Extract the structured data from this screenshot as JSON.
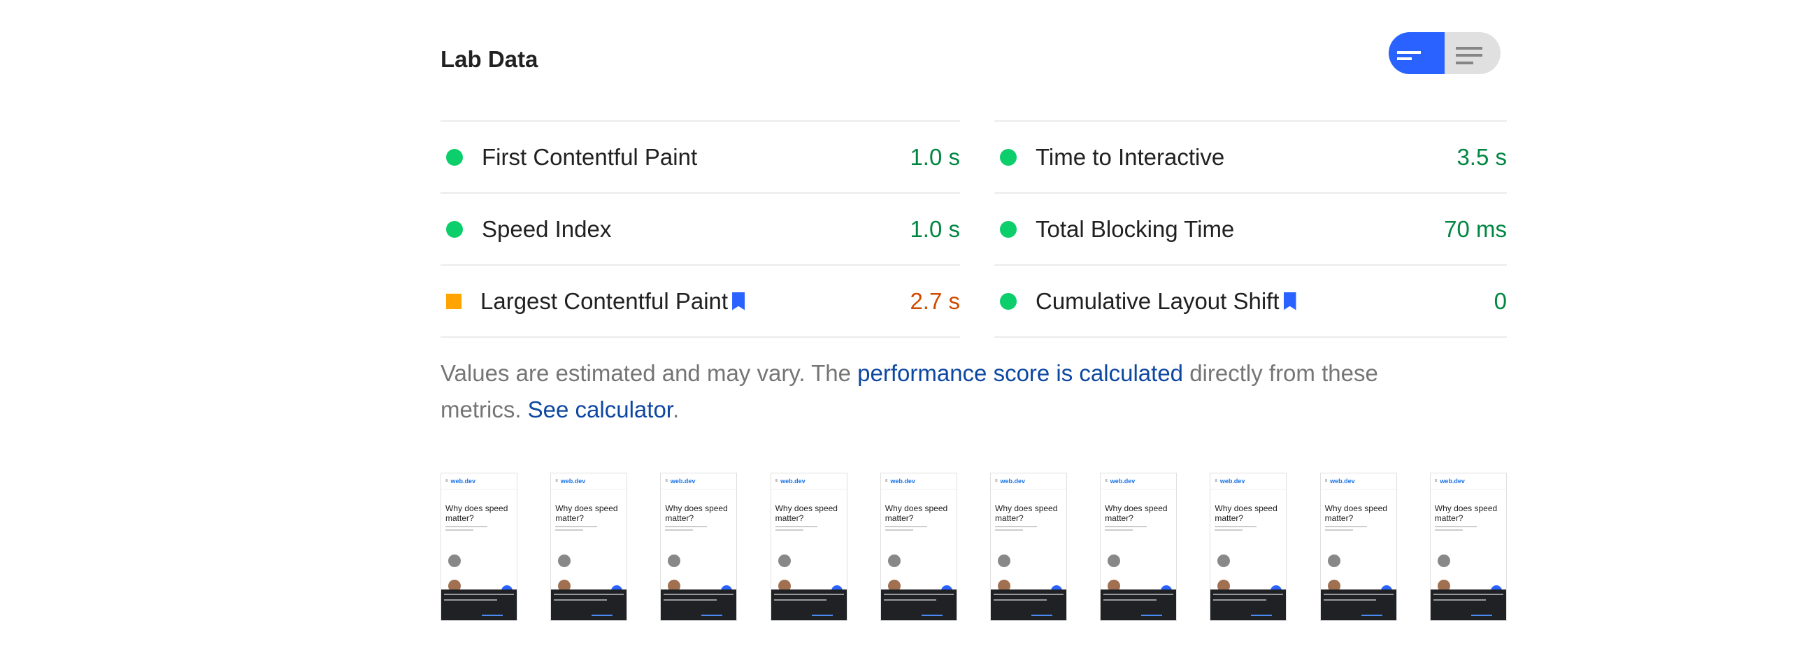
{
  "section_title": "Lab Data",
  "view_toggle": {
    "options": [
      "summary-view",
      "detail-view"
    ],
    "selected": "summary-view",
    "accent": "#2962ff"
  },
  "metrics_left": [
    {
      "name": "First Contentful Paint",
      "value": "1.0 s",
      "status": "pass",
      "bookmark": false
    },
    {
      "name": "Speed Index",
      "value": "1.0 s",
      "status": "pass",
      "bookmark": false
    },
    {
      "name": "Largest Contentful Paint",
      "value": "2.7 s",
      "status": "average",
      "bookmark": true
    }
  ],
  "metrics_right": [
    {
      "name": "Time to Interactive",
      "value": "3.5 s",
      "status": "pass",
      "bookmark": false
    },
    {
      "name": "Total Blocking Time",
      "value": "70 ms",
      "status": "pass",
      "bookmark": false
    },
    {
      "name": "Cumulative Layout Shift",
      "value": "0",
      "status": "pass",
      "bookmark": true
    }
  ],
  "colors": {
    "pass": "#0cce6b",
    "average": "#ffa400",
    "pass_text": "#018642",
    "average_text": "#d04900"
  },
  "note": {
    "t1": "Values are estimated and may vary. The ",
    "link1": "performance score is calculated",
    "t2": " directly from these metrics. ",
    "link2": "See calculator",
    "t3": "."
  },
  "filmstrip": {
    "count": 10,
    "thumb_logo": "web.dev",
    "thumb_heading": "Why does speed matter?"
  }
}
